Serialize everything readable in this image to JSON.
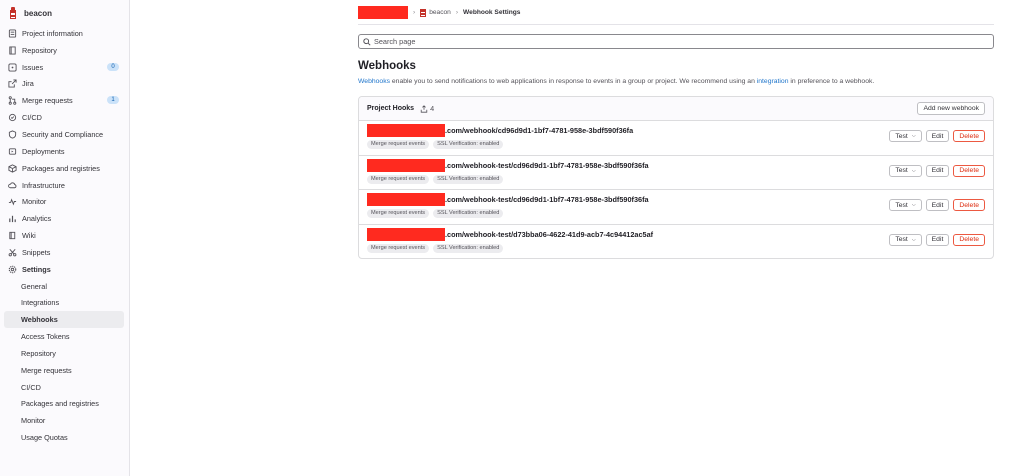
{
  "sidebar": {
    "project_name": "beacon",
    "items": [
      {
        "label": "Project information",
        "icon": "project-icon"
      },
      {
        "label": "Repository",
        "icon": "repository-icon"
      },
      {
        "label": "Issues",
        "icon": "issues-icon",
        "badge": "0"
      },
      {
        "label": "Jira",
        "icon": "external-link-icon"
      },
      {
        "label": "Merge requests",
        "icon": "merge-request-icon",
        "badge": "1"
      },
      {
        "label": "CI/CD",
        "icon": "rocket-icon"
      },
      {
        "label": "Security and Compliance",
        "icon": "shield-icon"
      },
      {
        "label": "Deployments",
        "icon": "deployments-icon"
      },
      {
        "label": "Packages and registries",
        "icon": "package-icon"
      },
      {
        "label": "Infrastructure",
        "icon": "cloud-icon"
      },
      {
        "label": "Monitor",
        "icon": "monitor-icon"
      },
      {
        "label": "Analytics",
        "icon": "analytics-icon"
      },
      {
        "label": "Wiki",
        "icon": "book-icon"
      },
      {
        "label": "Snippets",
        "icon": "snippet-icon"
      },
      {
        "label": "Settings",
        "icon": "settings-icon"
      }
    ],
    "settings_sub": [
      "General",
      "Integrations",
      "Webhooks",
      "Access Tokens",
      "Repository",
      "Merge requests",
      "CI/CD",
      "Packages and registries",
      "Monitor",
      "Usage Quotas"
    ],
    "active_sub": "Webhooks"
  },
  "breadcrumb": {
    "project": "beacon",
    "current": "Webhook Settings",
    "separator": "›"
  },
  "search": {
    "placeholder": "Search page"
  },
  "page": {
    "title": "Webhooks",
    "desc_link1": "Webhooks",
    "desc_middle": " enable you to send notifications to web applications in response to events in a group or project. We recommend using an ",
    "desc_link2": "integration",
    "desc_end": " in preference to a webhook."
  },
  "hooks_card": {
    "title": "Project Hooks",
    "count": "4",
    "add_label": "Add new webhook"
  },
  "hooks": [
    {
      "url_suffix": ".com/webhook/cd96d9d1-1bf7-4781-958e-3bdf590f36fa",
      "tag1": "Merge request events",
      "tag2": "SSL Verification: enabled"
    },
    {
      "url_suffix": ".com/webhook-test/cd96d9d1-1bf7-4781-958e-3bdf590f36fa",
      "tag1": "Merge request events",
      "tag2": "SSL Verification: enabled"
    },
    {
      "url_suffix": ".com/webhook-test/cd96d9d1-1bf7-4781-958e-3bdf590f36fa",
      "tag1": "Merge request events",
      "tag2": "SSL Verification: enabled"
    },
    {
      "url_suffix": ".com/webhook-test/d73bba06-4622-41d9-acb7-4c94412ac5af",
      "tag1": "Merge request events",
      "tag2": "SSL Verification: enabled"
    }
  ],
  "hook_actions": {
    "test": "Test",
    "edit": "Edit",
    "delete": "Delete"
  },
  "colors": {
    "redaction": "#ff2a1f",
    "link": "#1f75cb",
    "danger": "#dd2b0e",
    "active_bg": "#ececef"
  }
}
